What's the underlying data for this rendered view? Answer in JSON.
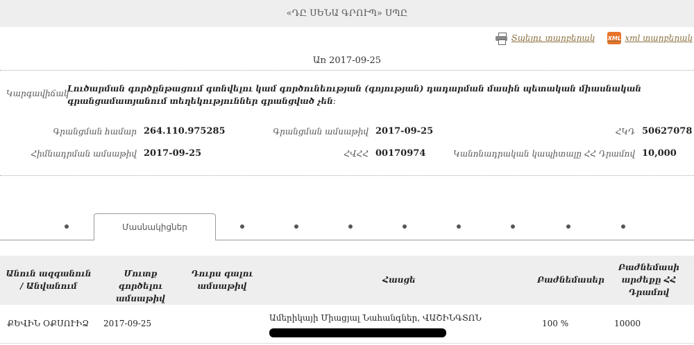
{
  "header": {
    "title": "«ԴԸ ՍԵՆԱ ԳՐՈՒՊ» ՍՊԸ"
  },
  "exports": {
    "print_label": "Տպելու տարբերակ",
    "xml_badge": "XML",
    "xml_label": "xml տարբերակ"
  },
  "as_of": "Առ 2017-09-25",
  "status": {
    "label": "Կարգավիճակ",
    "text": "Լուծարման գործընթացում գտնվելու կամ գործունեության (գոյության) դադարման մասին պետական միասնական գրանցամատյանում տեղեկություններ գրանցված չեն։"
  },
  "details": {
    "reg_number_label": "Գրանցման համար",
    "reg_number": "264.110.975285",
    "reg_date_label": "Գրանցման ամսաթիվ",
    "reg_date": "2017-09-25",
    "tin_label": "ՀԿԴ",
    "tin": "50627078",
    "founding_date_label": "Հիմնադրման ամսաթիվ",
    "founding_date": "2017-09-25",
    "taxid_label": "ՀՎՀՀ",
    "taxid": "00170974",
    "capital_label": "Կանոնադրական կապիտալը ՀՀ Դրամով",
    "capital": "10,000"
  },
  "tabs": {
    "active_label": "Մասնակիցներ"
  },
  "table": {
    "headers": [
      "Անուն ազգանուն / Անվանում",
      "Մուտք գործելու ամսաթիվ",
      "Դուրս գալու ամսաթիվ",
      "Հասցե",
      "Բաժնեմասեր",
      "Բաժնեմասի արժեքը ՀՀ Դրամով"
    ],
    "rows": [
      {
        "name": "ՔԵՎԻՆ ՕՔՍՈՒԻՁ",
        "entry_date": "2017-09-25",
        "exit_date": "",
        "address": "Ամերիկայի Միացյալ Նահանգներ, ՎԱՇԻՆԳՏՈՆ",
        "share": "100 %",
        "share_value": "10000"
      }
    ]
  },
  "colors": {
    "header_bg": "#eeeeee",
    "link": "#8a6d3b",
    "xml_badge": "#e8742a"
  }
}
